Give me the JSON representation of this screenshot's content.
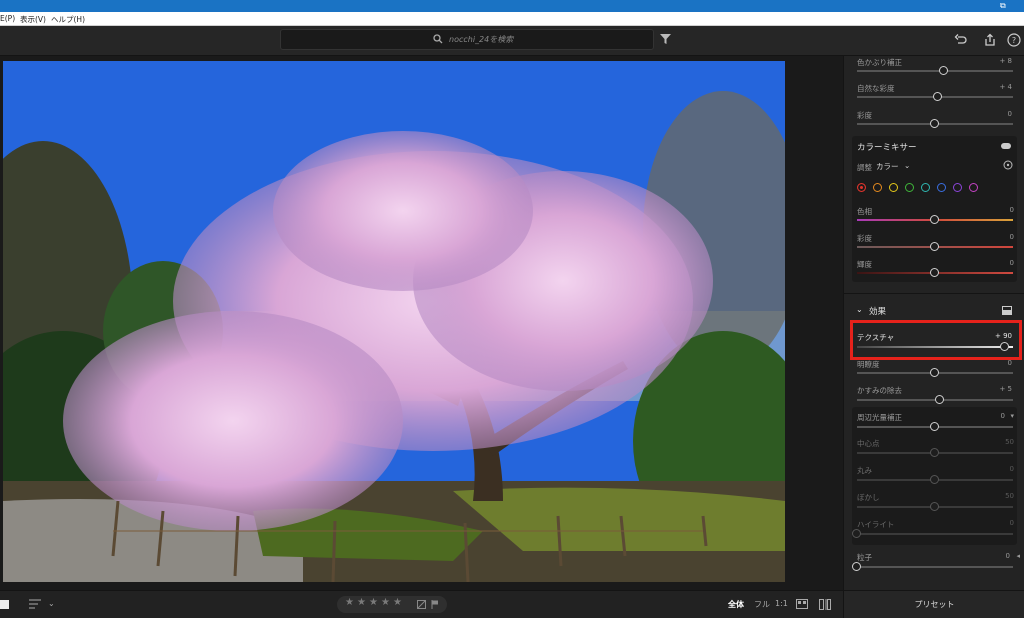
{
  "window": {
    "restore_glyph": "⧉"
  },
  "menubar": {
    "items": [
      "E(P)",
      "表示(V)",
      "ヘルプ(H)"
    ]
  },
  "toolbar": {
    "search_placeholder": "nocchi_24を検索"
  },
  "panel": {
    "color_top": {
      "rows": [
        {
          "label": "色かぶり補正",
          "value": "+ 8",
          "pct": 0.56
        },
        {
          "label": "自然な彩度",
          "value": "+ 4",
          "pct": 0.52
        },
        {
          "label": "彩度",
          "value": "0",
          "pct": 0.5
        }
      ]
    },
    "color_mixer": {
      "title": "カラーミキサー",
      "adjust_label": "調整",
      "adjust_value": "カラー",
      "dot_colors": [
        "#e0342c",
        "#e58a1f",
        "#e4c81a",
        "#3fb53a",
        "#2fb6b0",
        "#3a6ee0",
        "#8b45d9",
        "#c443c4"
      ],
      "rows": [
        {
          "label": "色相",
          "value": "0",
          "pct": 0.5
        },
        {
          "label": "彩度",
          "value": "0",
          "pct": 0.5
        },
        {
          "label": "輝度",
          "value": "0",
          "pct": 0.5
        }
      ]
    },
    "effects": {
      "title": "効果",
      "rows": [
        {
          "label": "テクスチャ",
          "value": "+ 90",
          "pct": 0.95
        },
        {
          "label": "明瞭度",
          "value": "0",
          "pct": 0.5
        },
        {
          "label": "かすみの除去",
          "value": "+ 5",
          "pct": 0.53
        }
      ],
      "vignette": {
        "label": "周辺光量補正",
        "value": "0",
        "rows": [
          {
            "label": "中心点",
            "value": "50",
            "pct": 0.5
          },
          {
            "label": "丸み",
            "value": "0",
            "pct": 0.5
          },
          {
            "label": "ぼかし",
            "value": "50",
            "pct": 0.5
          },
          {
            "label": "ハイライト",
            "value": "0",
            "pct": 0.0
          }
        ]
      },
      "grain": {
        "label": "粒子",
        "value": "0",
        "pct": 0.0
      }
    }
  },
  "bottom": {
    "stars": [
      "★",
      "★",
      "★",
      "★",
      "★"
    ],
    "view_full_all": "全体",
    "view_full": "フル",
    "view_1to1": "1:1",
    "presets_label": "プリセット"
  },
  "colors": {
    "accent_red": "#e6221b",
    "panel_bg": "#232323",
    "sky": "#2a6ae0"
  }
}
